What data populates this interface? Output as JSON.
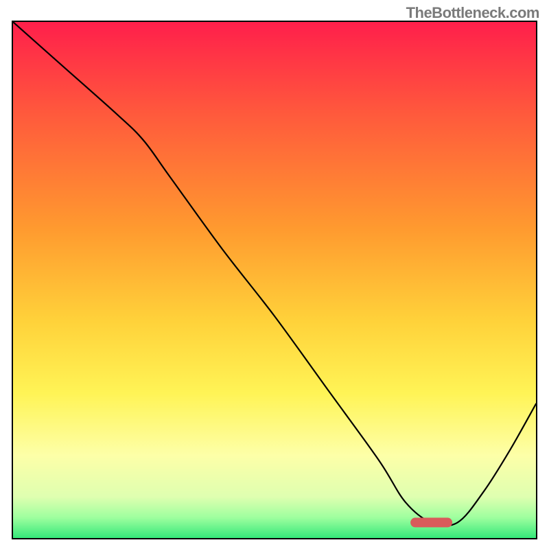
{
  "watermark": "TheBottleneck.com",
  "chart_data": {
    "type": "line",
    "title": "",
    "xlabel": "",
    "ylabel": "",
    "xlim": [
      0,
      100
    ],
    "ylim": [
      0,
      100
    ],
    "grid": false,
    "legend": false,
    "background_gradient": {
      "stops": [
        {
          "offset": 0,
          "color": "#ff1f4b"
        },
        {
          "offset": 18,
          "color": "#ff5a3c"
        },
        {
          "offset": 40,
          "color": "#ff9a2f"
        },
        {
          "offset": 58,
          "color": "#ffd23a"
        },
        {
          "offset": 72,
          "color": "#fff456"
        },
        {
          "offset": 84,
          "color": "#fdffa8"
        },
        {
          "offset": 92,
          "color": "#dfffb0"
        },
        {
          "offset": 96,
          "color": "#9fff9f"
        },
        {
          "offset": 100,
          "color": "#35e87a"
        }
      ]
    },
    "series": [
      {
        "name": "bottleneck-curve",
        "x": [
          0,
          10,
          20,
          25,
          30,
          40,
          50,
          60,
          70,
          75,
          80,
          85,
          90,
          95,
          100
        ],
        "y": [
          100,
          91,
          82,
          77,
          70,
          56,
          43,
          29,
          15,
          7,
          3,
          3,
          9,
          17,
          26
        ]
      }
    ],
    "marker": {
      "name": "optimum-marker",
      "x_center": 80,
      "y": 3,
      "width": 8,
      "color": "#d95b5b"
    }
  }
}
